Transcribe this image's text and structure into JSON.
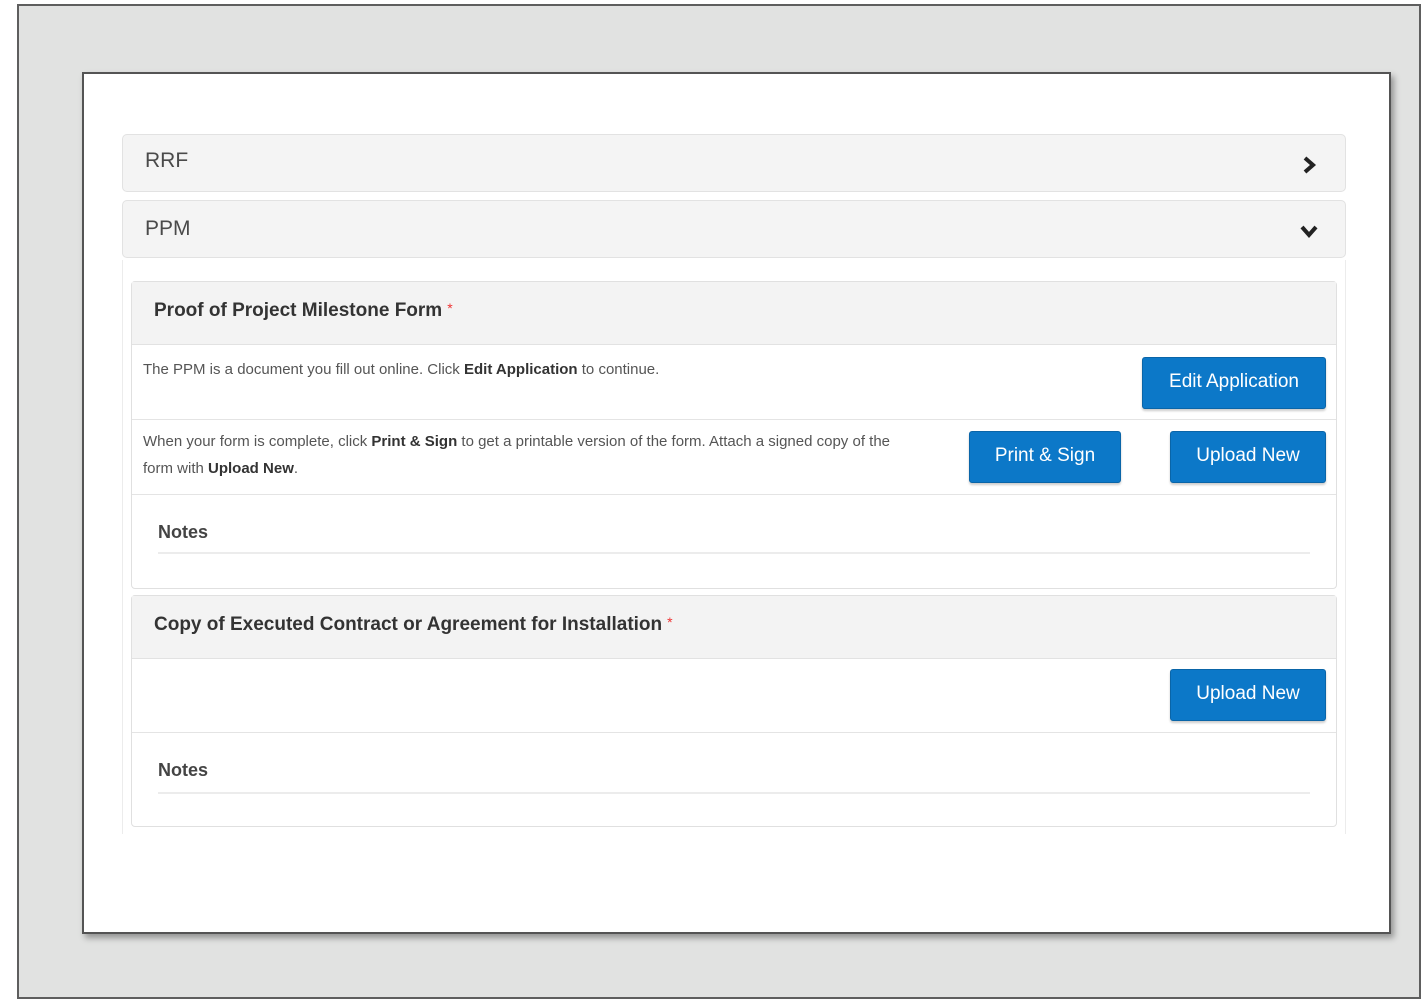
{
  "accordion": {
    "rrf": {
      "title": "RRF"
    },
    "ppm": {
      "title": "PPM"
    }
  },
  "ppm_form": {
    "title": "Proof of Project Milestone Form",
    "required_marker": "*",
    "row1": {
      "text_a": "The PPM is a document you fill out online. Click ",
      "text_bold": "Edit Application",
      "text_b": " to continue.",
      "button": "Edit Application"
    },
    "row2": {
      "text_a": "When your form is complete, click ",
      "text_bold1": "Print & Sign",
      "text_b": " to get a printable version of the form. Attach a signed copy of the form with ",
      "text_bold2": "Upload New",
      "text_c": ".",
      "print_button": "Print & Sign",
      "upload_button": "Upload New"
    },
    "notes_label": "Notes"
  },
  "contract_form": {
    "title": "Copy of Executed Contract or Agreement for Installation",
    "required_marker": "*",
    "upload_button": "Upload New",
    "notes_label": "Notes"
  },
  "icons": [
    "chevron-right-icon",
    "chevron-down-icon"
  ],
  "colors": {
    "button_blue": "#0c78c8",
    "required_red": "#e33333"
  }
}
